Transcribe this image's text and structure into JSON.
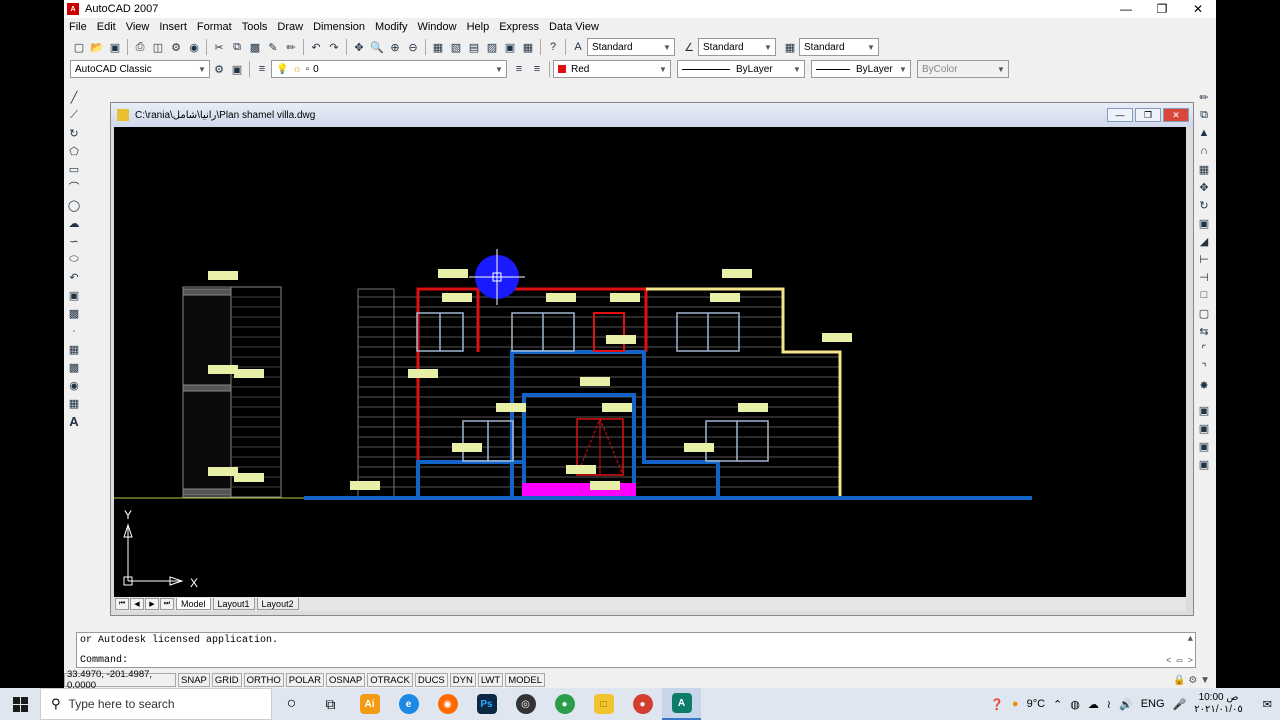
{
  "app": {
    "title": "AutoCAD 2007"
  },
  "menu": [
    "File",
    "Edit",
    "View",
    "Insert",
    "Format",
    "Tools",
    "Draw",
    "Dimension",
    "Modify",
    "Window",
    "Help",
    "Express",
    "Data View"
  ],
  "styles": {
    "text_style": "Standard",
    "dim_style": "Standard",
    "table_style": "Standard"
  },
  "workspace": "AutoCAD Classic",
  "layer": "0",
  "properties": {
    "color": "Red",
    "color_hex": "#e01010",
    "linetype": "ByLayer",
    "lineweight": "ByLayer",
    "plotstyle": "ByColor"
  },
  "drawing": {
    "title": "C:\\rania\\رانيا\\شامل\\Plan shamel villa.dwg"
  },
  "tabs": [
    "Model",
    "Layout1",
    "Layout2"
  ],
  "ucs": {
    "x_label": "X",
    "y_label": "Y"
  },
  "command": {
    "history": "or Autodesk licensed application.",
    "prompt": "Command:"
  },
  "status": {
    "coords": "33.4970, -201.4987, 0.0000",
    "toggles": [
      "SNAP",
      "GRID",
      "ORTHO",
      "POLAR",
      "OSNAP",
      "OTRACK",
      "DUCS",
      "DYN",
      "LWT",
      "MODEL"
    ]
  },
  "taskbar": {
    "search_placeholder": "Type here to search",
    "temperature": "9°C",
    "language": "ENG",
    "time": "10:00 ص",
    "date": "٢٠٢١/٠١/٠٥"
  }
}
